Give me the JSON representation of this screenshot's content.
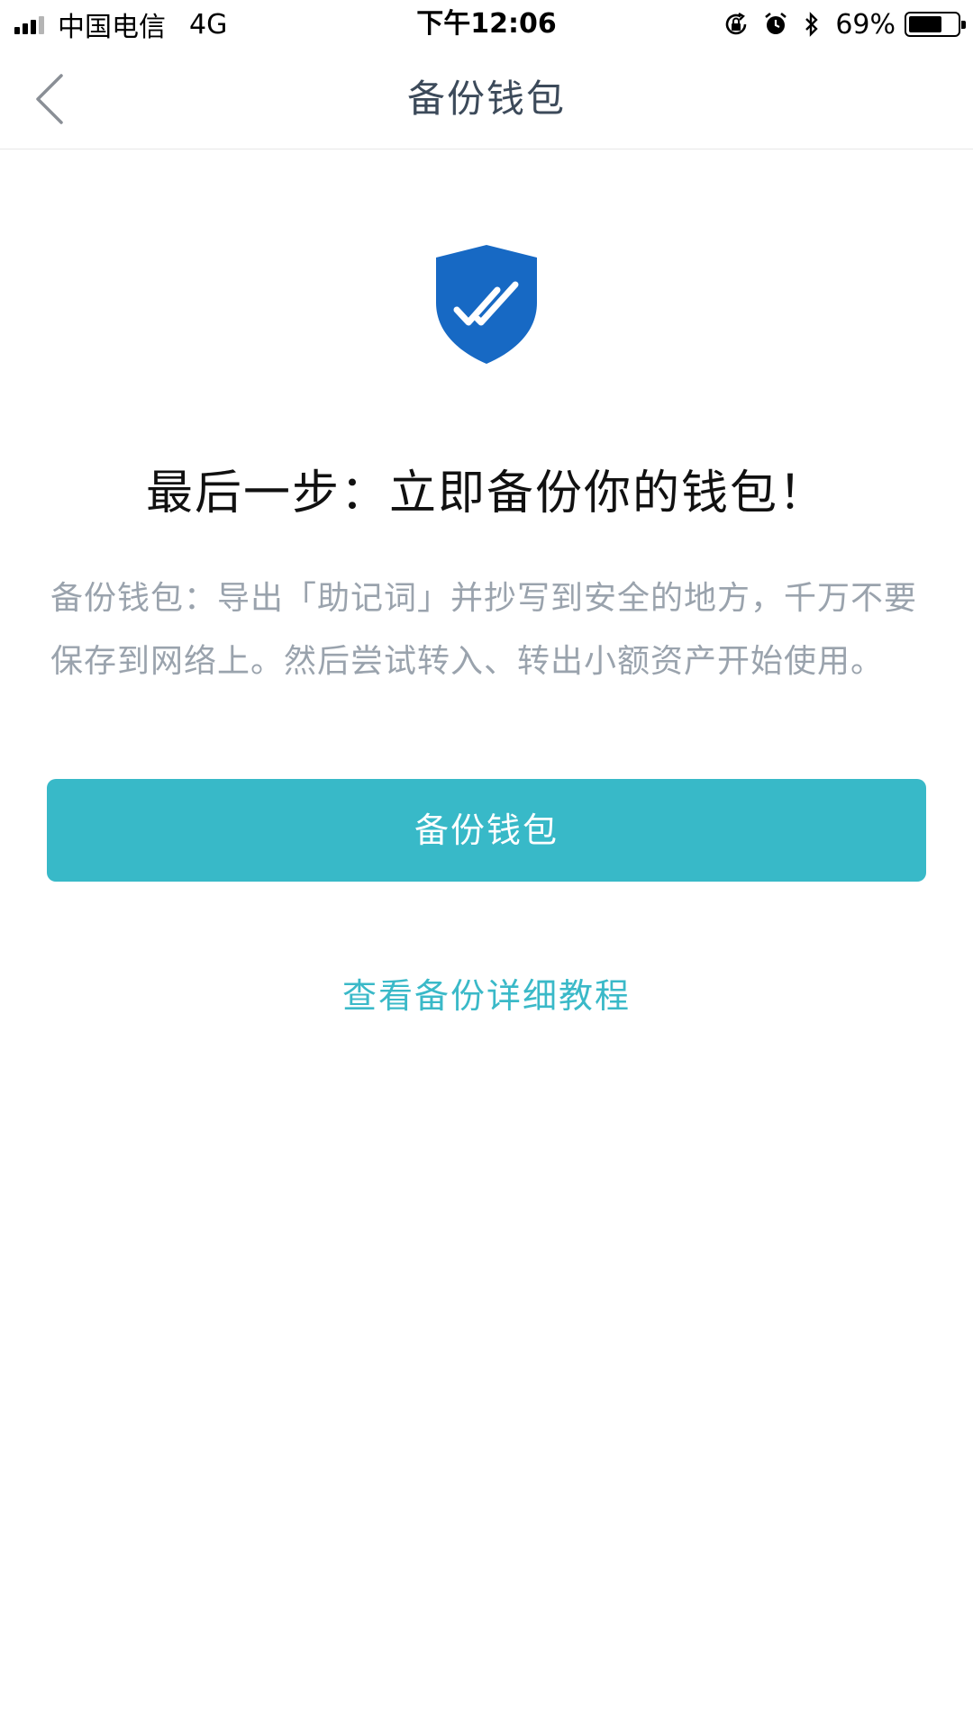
{
  "status_bar": {
    "carrier": "中国电信",
    "network": "4G",
    "time": "下午12:06",
    "battery_percent": "69%",
    "battery_level": 0.69,
    "icons": [
      "signal-icon",
      "orientation-lock-icon",
      "alarm-icon",
      "bluetooth-icon",
      "battery-icon"
    ]
  },
  "nav": {
    "title": "备份钱包",
    "back_icon": "chevron-left-icon"
  },
  "content": {
    "icon": "shield-check-icon",
    "headline": "最后一步：立即备份你的钱包！",
    "description": "备份钱包：导出「助记词」并抄写到安全的地方，千万不要保存到网络上。然后尝试转入、转出小额资产开始使用。"
  },
  "actions": {
    "backup_button": "备份钱包",
    "tutorial_link": "查看备份详细教程"
  },
  "colors": {
    "accent": "#38b9c8",
    "shield": "#1769c4",
    "title_text": "#3c4a5a",
    "description_text": "#9aa3ad"
  }
}
